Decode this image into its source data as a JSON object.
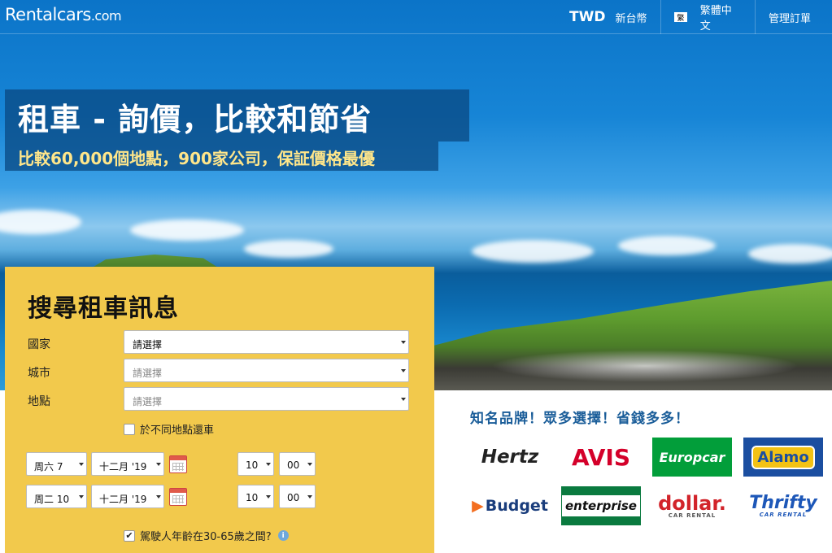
{
  "header": {
    "logo_text": "Rentalcars",
    "logo_suffix": ".com",
    "currency_code": "TWD",
    "currency_name": "新台幣",
    "language_flag": "繁",
    "language": "繁體中文",
    "manage_booking": "管理訂單"
  },
  "hero": {
    "headline": "租車 - 詢價，比較和節省",
    "subline": "比較60,000個地點，900家公司，保証價格最優"
  },
  "search": {
    "title": "搜尋租車訊息",
    "country_label": "國家",
    "country_value": "請選擇",
    "city_label": "城市",
    "city_value": "請選擇",
    "location_label": "地點",
    "location_value": "請選擇",
    "different_return_label": "於不同地點還車",
    "pickup": {
      "day": "周六 7",
      "month": "十二月 '19",
      "hour": "10",
      "minute": "00"
    },
    "dropoff": {
      "day": "周二 10",
      "month": "十二月 '19",
      "hour": "10",
      "minute": "00"
    },
    "driver_age_label": "駕駛人年齡在30-65歲之間?",
    "info_icon_text": "i"
  },
  "brands": {
    "title": "知名品牌！眾多選擇！省錢多多！",
    "hertz": "Hertz",
    "avis": "AVIS",
    "europcar": "Europcar",
    "alamo": "Alamo",
    "budget_arrow": "▶",
    "budget": "Budget",
    "enterprise": "enterprise",
    "dollar": "dollar.",
    "dollar_sub": "CAR RENTAL",
    "thrifty": "Thrifty",
    "thrifty_sub": "CAR RENTAL"
  }
}
